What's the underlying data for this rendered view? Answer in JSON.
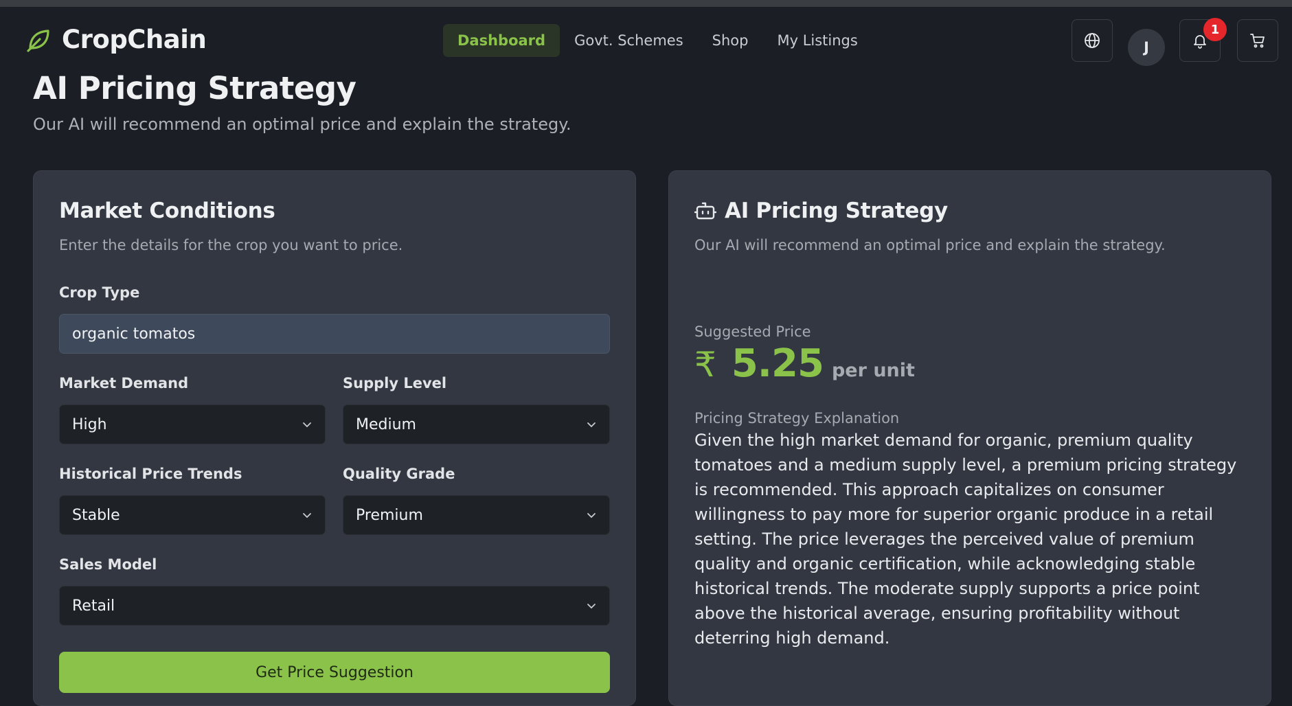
{
  "brand": {
    "name": "CropChain",
    "accent": "#8bc34a"
  },
  "nav": {
    "items": [
      {
        "label": "Dashboard",
        "active": true
      },
      {
        "label": "Govt. Schemes",
        "active": false
      },
      {
        "label": "Shop",
        "active": false
      },
      {
        "label": "My Listings",
        "active": false
      }
    ]
  },
  "header": {
    "avatar_initial": "J",
    "notification_count": "1",
    "icons": [
      "globe-icon",
      "bell-icon",
      "cart-icon"
    ]
  },
  "page": {
    "title": "AI Pricing Strategy",
    "subtitle": "Our AI will recommend an optimal price and explain the strategy."
  },
  "form": {
    "title": "Market Conditions",
    "subtitle": "Enter the details for the crop you want to price.",
    "crop_type": {
      "label": "Crop Type",
      "value": "organic tomatos"
    },
    "market_demand": {
      "label": "Market Demand",
      "value": "High"
    },
    "supply_level": {
      "label": "Supply Level",
      "value": "Medium"
    },
    "historical_trends": {
      "label": "Historical Price Trends",
      "value": "Stable"
    },
    "quality_grade": {
      "label": "Quality Grade",
      "value": "Premium"
    },
    "sales_model": {
      "label": "Sales Model",
      "value": "Retail"
    },
    "submit_label": "Get Price Suggestion"
  },
  "result": {
    "title": "AI Pricing Strategy",
    "subtitle": "Our AI will recommend an optimal price and explain the strategy.",
    "suggested_label": "Suggested Price",
    "currency_symbol": "₹",
    "price": "5.25",
    "unit": "per unit",
    "explanation_label": "Pricing Strategy Explanation",
    "explanation": "Given the high market demand for organic, premium quality tomatoes and a medium supply level, a premium pricing strategy is recommended. This approach capitalizes on consumer willingness to pay more for superior organic produce in a retail setting. The price leverages the perceived value of premium quality and organic certification, while acknowledging stable historical trends. The moderate supply supports a price point above the historical average, ensuring profitability without deterring high demand."
  }
}
